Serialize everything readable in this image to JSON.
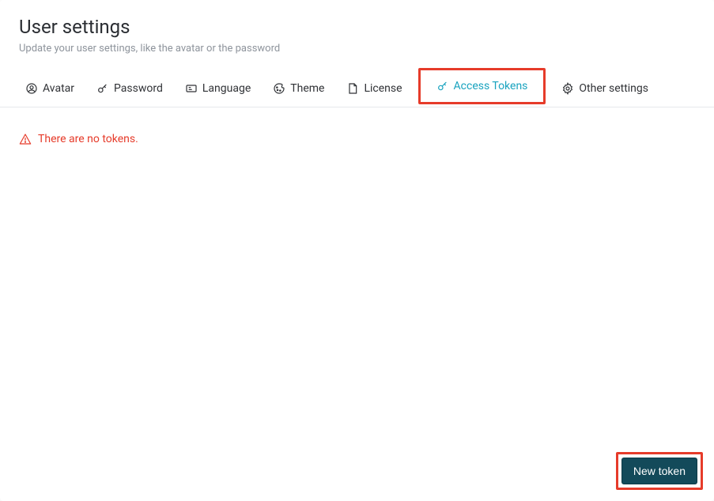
{
  "header": {
    "title": "User settings",
    "subtitle": "Update your user settings, like the avatar or the password"
  },
  "tabs": {
    "avatar": "Avatar",
    "password": "Password",
    "language": "Language",
    "theme": "Theme",
    "license": "License",
    "access_tokens": "Access Tokens",
    "other": "Other settings"
  },
  "content": {
    "empty_tokens_message": "There are no tokens."
  },
  "actions": {
    "new_token": "New token"
  }
}
